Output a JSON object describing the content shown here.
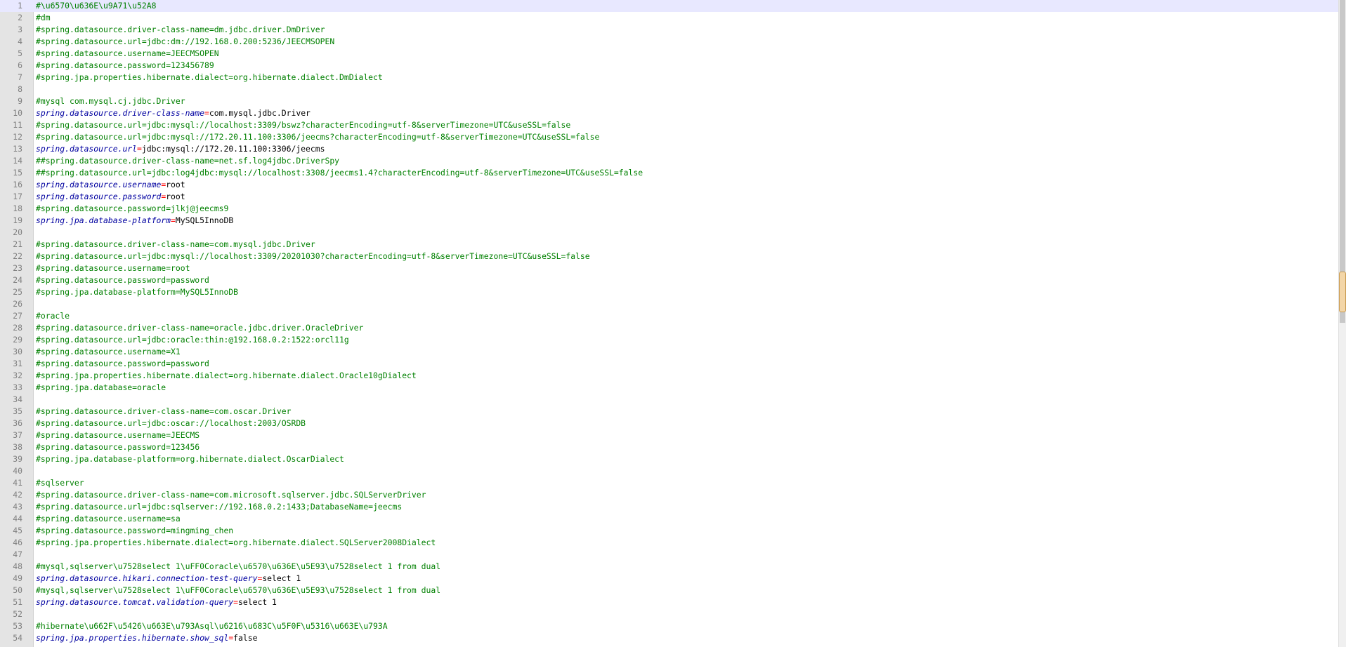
{
  "editor": {
    "lines": [
      {
        "n": "1",
        "type": "comment",
        "text": "#\\u6570\\u636E\\u9A71\\u52A8"
      },
      {
        "n": "2",
        "type": "comment",
        "text": "#dm"
      },
      {
        "n": "3",
        "type": "comment",
        "text": "#spring.datasource.driver-class-name=dm.jdbc.driver.DmDriver"
      },
      {
        "n": "4",
        "type": "comment",
        "text": "#spring.datasource.url=jdbc:dm://192.168.0.200:5236/JEECMSOPEN"
      },
      {
        "n": "5",
        "type": "comment",
        "text": "#spring.datasource.username=JEECMSOPEN"
      },
      {
        "n": "6",
        "type": "comment",
        "text": "#spring.datasource.password=123456789"
      },
      {
        "n": "7",
        "type": "comment",
        "text": "#spring.jpa.properties.hibernate.dialect=org.hibernate.dialect.DmDialect"
      },
      {
        "n": "8",
        "type": "blank",
        "text": ""
      },
      {
        "n": "9",
        "type": "comment",
        "text": "#mysql com.mysql.cj.jdbc.Driver"
      },
      {
        "n": "10",
        "type": "prop",
        "key": "spring.datasource.driver-class-name",
        "eq": "=",
        "value": "com.mysql.jdbc.Driver"
      },
      {
        "n": "11",
        "type": "comment",
        "text": "#spring.datasource.url=jdbc:mysql://localhost:3309/bswz?characterEncoding=utf-8&serverTimezone=UTC&useSSL=false"
      },
      {
        "n": "12",
        "type": "comment",
        "text": "#spring.datasource.url=jdbc:mysql://172.20.11.100:3306/jeecms?characterEncoding=utf-8&serverTimezone=UTC&useSSL=false"
      },
      {
        "n": "13",
        "type": "prop",
        "key": "spring.datasource.url",
        "eq": "=",
        "value": "jdbc:mysql://172.20.11.100:3306/jeecms"
      },
      {
        "n": "14",
        "type": "comment",
        "text": "##spring.datasource.driver-class-name=net.sf.log4jdbc.DriverSpy"
      },
      {
        "n": "15",
        "type": "comment",
        "text": "##spring.datasource.url=jdbc:log4jdbc:mysql://localhost:3308/jeecms1.4?characterEncoding=utf-8&serverTimezone=UTC&useSSL=false"
      },
      {
        "n": "16",
        "type": "prop",
        "key": "spring.datasource.username",
        "eq": "=",
        "value": "root"
      },
      {
        "n": "17",
        "type": "prop",
        "key": "spring.datasource.password",
        "eq": "=",
        "value": "root"
      },
      {
        "n": "18",
        "type": "comment",
        "text": "#spring.datasource.password=jlkj@jeecms9"
      },
      {
        "n": "19",
        "type": "prop",
        "key": "spring.jpa.database-platform",
        "eq": "=",
        "value": "MySQL5InnoDB"
      },
      {
        "n": "20",
        "type": "blank",
        "text": ""
      },
      {
        "n": "21",
        "type": "comment",
        "text": "#spring.datasource.driver-class-name=com.mysql.jdbc.Driver"
      },
      {
        "n": "22",
        "type": "comment",
        "text": "#spring.datasource.url=jdbc:mysql://localhost:3309/20201030?characterEncoding=utf-8&serverTimezone=UTC&useSSL=false"
      },
      {
        "n": "23",
        "type": "comment",
        "text": "#spring.datasource.username=root"
      },
      {
        "n": "24",
        "type": "comment",
        "text": "#spring.datasource.password=password"
      },
      {
        "n": "25",
        "type": "comment",
        "text": "#spring.jpa.database-platform=MySQL5InnoDB"
      },
      {
        "n": "26",
        "type": "blank",
        "text": ""
      },
      {
        "n": "27",
        "type": "comment",
        "text": "#oracle"
      },
      {
        "n": "28",
        "type": "comment",
        "text": "#spring.datasource.driver-class-name=oracle.jdbc.driver.OracleDriver"
      },
      {
        "n": "29",
        "type": "comment",
        "text": "#spring.datasource.url=jdbc:oracle:thin:@192.168.0.2:1522:orcl11g"
      },
      {
        "n": "30",
        "type": "comment",
        "text": "#spring.datasource.username=X1"
      },
      {
        "n": "31",
        "type": "comment",
        "text": "#spring.datasource.password=password"
      },
      {
        "n": "32",
        "type": "comment",
        "text": "#spring.jpa.properties.hibernate.dialect=org.hibernate.dialect.Oracle10gDialect"
      },
      {
        "n": "33",
        "type": "comment",
        "text": "#spring.jpa.database=oracle"
      },
      {
        "n": "34",
        "type": "blank",
        "text": ""
      },
      {
        "n": "35",
        "type": "comment",
        "text": "#spring.datasource.driver-class-name=com.oscar.Driver"
      },
      {
        "n": "36",
        "type": "comment",
        "text": "#spring.datasource.url=jdbc:oscar://localhost:2003/OSRDB"
      },
      {
        "n": "37",
        "type": "comment",
        "text": "#spring.datasource.username=JEECMS"
      },
      {
        "n": "38",
        "type": "comment",
        "text": "#spring.datasource.password=123456"
      },
      {
        "n": "39",
        "type": "comment",
        "text": "#spring.jpa.database-platform=org.hibernate.dialect.OscarDialect"
      },
      {
        "n": "40",
        "type": "blank",
        "text": ""
      },
      {
        "n": "41",
        "type": "comment",
        "text": "#sqlserver"
      },
      {
        "n": "42",
        "type": "comment",
        "text": "#spring.datasource.driver-class-name=com.microsoft.sqlserver.jdbc.SQLServerDriver"
      },
      {
        "n": "43",
        "type": "comment",
        "text": "#spring.datasource.url=jdbc:sqlserver://192.168.0.2:1433;DatabaseName=jeecms"
      },
      {
        "n": "44",
        "type": "comment",
        "text": "#spring.datasource.username=sa"
      },
      {
        "n": "45",
        "type": "comment",
        "text": "#spring.datasource.password=mingming_chen"
      },
      {
        "n": "46",
        "type": "comment",
        "text": "#spring.jpa.properties.hibernate.dialect=org.hibernate.dialect.SQLServer2008Dialect"
      },
      {
        "n": "47",
        "type": "blank",
        "text": ""
      },
      {
        "n": "48",
        "type": "comment",
        "text": "#mysql,sqlserver\\u7528select 1\\uFF0Coracle\\u6570\\u636E\\u5E93\\u7528select 1 from dual"
      },
      {
        "n": "49",
        "type": "prop",
        "key": "spring.datasource.hikari.connection-test-query",
        "eq": "=",
        "value": "select 1"
      },
      {
        "n": "50",
        "type": "comment",
        "text": "#mysql,sqlserver\\u7528select 1\\uFF0Coracle\\u6570\\u636E\\u5E93\\u7528select 1 from dual"
      },
      {
        "n": "51",
        "type": "prop",
        "key": "spring.datasource.tomcat.validation-query",
        "eq": "=",
        "value": "select 1"
      },
      {
        "n": "52",
        "type": "blank",
        "text": ""
      },
      {
        "n": "53",
        "type": "comment",
        "text": "#hibernate\\u662F\\u5426\\u663E\\u793Asql\\u6216\\u683C\\u5F0F\\u5316\\u663E\\u793A"
      },
      {
        "n": "54",
        "type": "prop",
        "key": "spring.jpa.properties.hibernate.show_sql",
        "eq": "=",
        "value": "false"
      }
    ]
  },
  "colors": {
    "comment": "#008000",
    "key": "#0000a0",
    "equals": "#ff0000",
    "value": "#000000",
    "gutter_bg": "#e4e4e4",
    "current_line_bg": "#e8e8ff"
  }
}
